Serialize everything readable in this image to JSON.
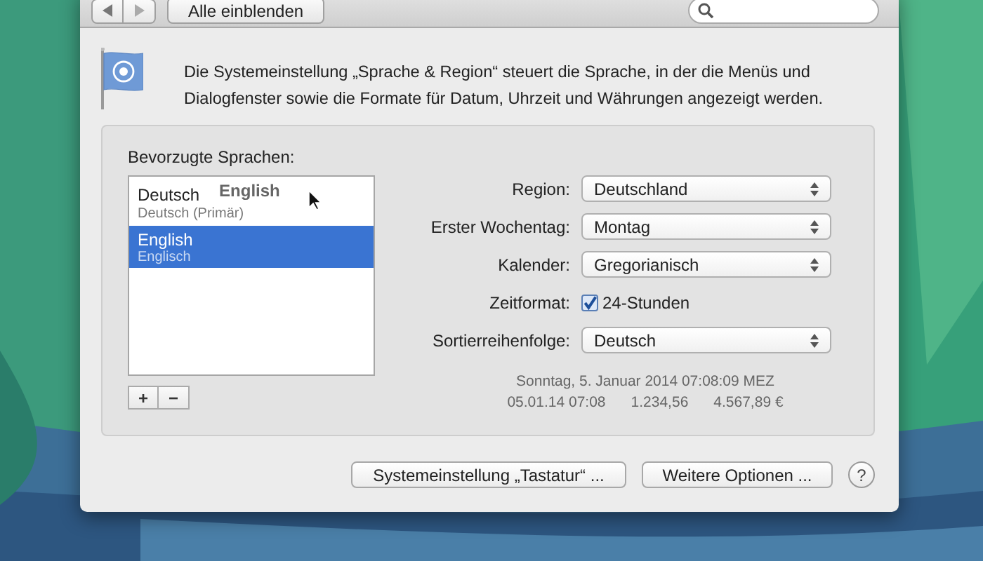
{
  "toolbar": {
    "show_all": "Alle einblenden"
  },
  "description": "Die Systemeinstellung „Sprache & Region“ steuert die Sprache, in der die Menüs und Dialogfenster sowie die Formate für Datum, Uhrzeit und Währungen angezeigt werden.",
  "languages": {
    "label": "Bevorzugte Sprachen:",
    "items": [
      {
        "name": "Deutsch",
        "note": "Deutsch (Primär)",
        "selected": false
      },
      {
        "name": "English",
        "note": "Englisch",
        "selected": true
      }
    ],
    "drag_ghost": "English",
    "buttons": [
      "+",
      "−"
    ]
  },
  "settings": [
    {
      "kind": "popup",
      "label": "Region:",
      "value": "Deutschland"
    },
    {
      "kind": "popup",
      "label": "Erster Wochentag:",
      "value": "Montag"
    },
    {
      "kind": "popup",
      "label": "Kalender:",
      "value": "Gregorianisch"
    },
    {
      "kind": "checkbox",
      "label": "Zeitformat:",
      "value": "24-Stunden",
      "checked": true
    },
    {
      "kind": "popup",
      "label": "Sortierreihenfolge:",
      "value": "Deutsch"
    }
  ],
  "preview": {
    "date": "Sonntag, 5. Januar 2014 07:08:09 MEZ",
    "samples": [
      "05.01.14 07:08",
      "1.234,56",
      "4.567,89 €"
    ]
  },
  "footer_buttons": [
    "Systemeinstellung „Tastatur“ ...",
    "Weitere Optionen ..."
  ],
  "help": "?"
}
